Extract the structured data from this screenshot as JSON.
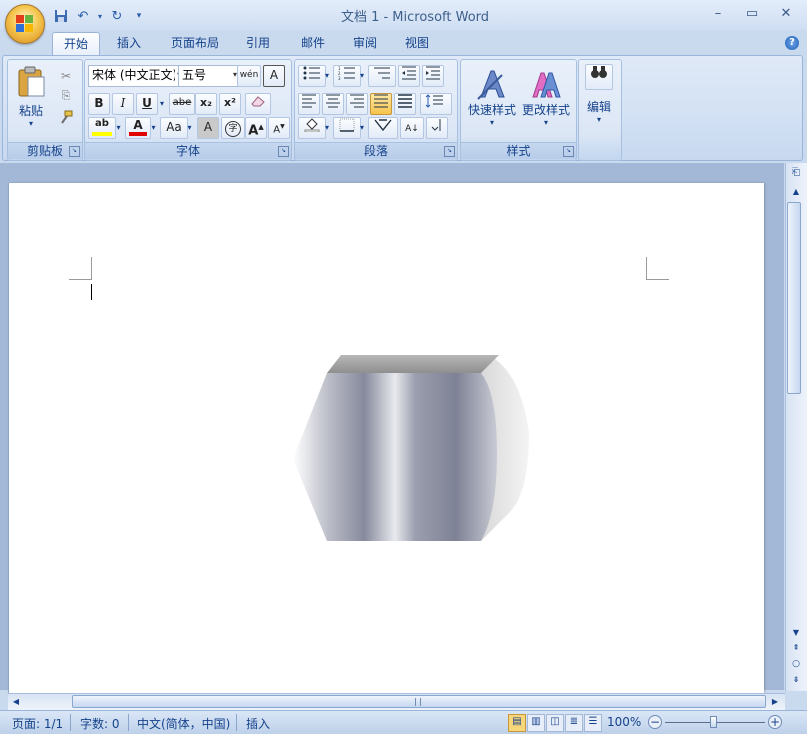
{
  "window": {
    "title": "文档 1 - Microsoft Word",
    "controls": {
      "minimize": "–",
      "maximize": "▭",
      "close": "✕"
    }
  },
  "qat": {
    "customize": "▾"
  },
  "tabs": [
    {
      "label": "开始",
      "active": true
    },
    {
      "label": "插入"
    },
    {
      "label": "页面布局"
    },
    {
      "label": "引用"
    },
    {
      "label": "邮件"
    },
    {
      "label": "审阅"
    },
    {
      "label": "视图"
    }
  ],
  "help": "?",
  "ribbon": {
    "clipboard": {
      "label": "剪贴板",
      "paste": "粘贴"
    },
    "font": {
      "label": "字体",
      "font_name": "宋体 (中文正文)",
      "font_size": "五号",
      "bold": "B",
      "italic": "I",
      "underline": "U",
      "strike": "abe",
      "subscript": "x₂",
      "superscript": "x²",
      "phonetic": "wén",
      "char_border": "A",
      "highlight": "ab",
      "font_color": "A",
      "change_case": "Aa",
      "char_shading": "A",
      "enclose": "字",
      "grow": "A",
      "shrink": "A"
    },
    "paragraph": {
      "label": "段落",
      "sort": "A↓"
    },
    "styles": {
      "label": "样式",
      "quick_styles": "快速样式",
      "change_styles": "更改样式"
    },
    "editing": {
      "label": "编辑"
    }
  },
  "status": {
    "page": "页面: 1/1",
    "words": "字数: 0",
    "language": "中文(简体，中国)",
    "mode": "插入",
    "zoom": "100%",
    "zoom_out": "−",
    "zoom_in": "+"
  },
  "colors": {
    "ribbon_bg": "#d2e1f4",
    "highlight_yellow": "#ffff00",
    "font_red": "#e00000",
    "shape_gray": "#a6a9b6"
  }
}
